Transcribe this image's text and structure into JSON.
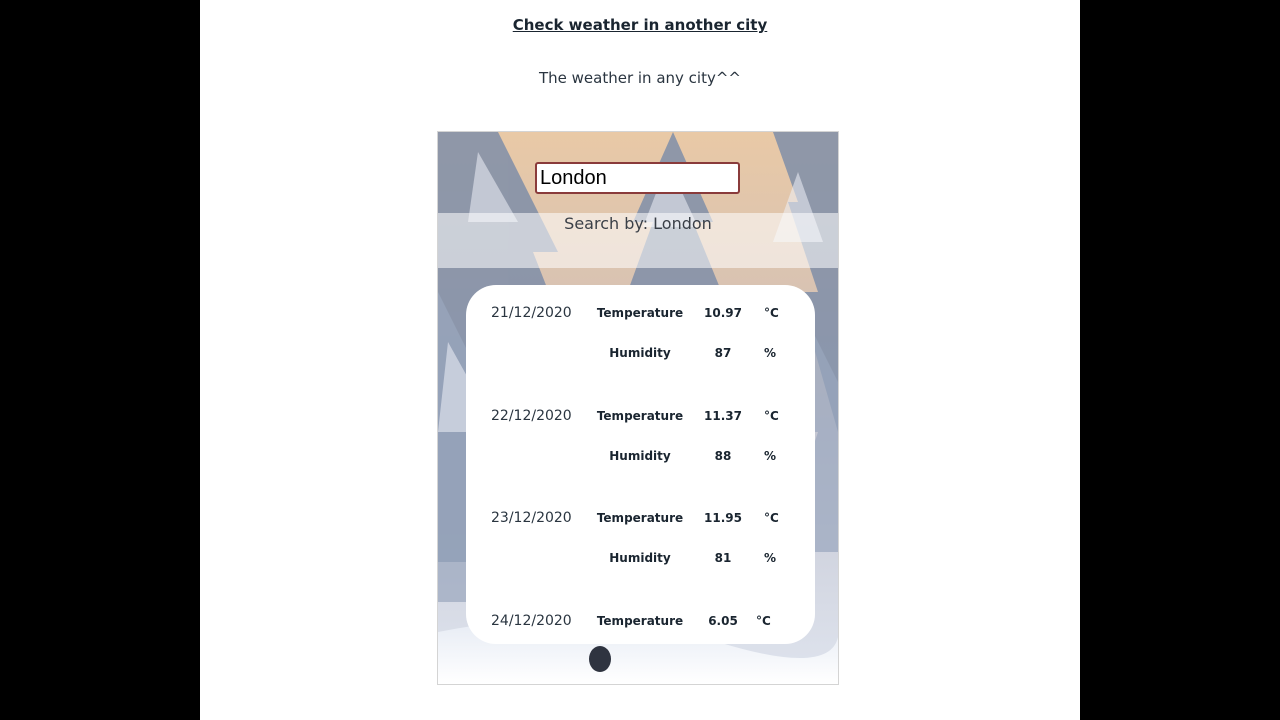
{
  "header": {
    "link_label": "Check weather in another city",
    "subtitle": "The weather in any city^^"
  },
  "search": {
    "input_value": "London",
    "search_by_label": "Search by: London"
  },
  "forecast": [
    {
      "date": "21/12/2020",
      "temperature_label": "Temperature",
      "temperature": "10.97",
      "temperature_unit": "°C",
      "humidity_label": "Humidity",
      "humidity": "87",
      "humidity_unit": "%"
    },
    {
      "date": "22/12/2020",
      "temperature_label": "Temperature",
      "temperature": "11.37",
      "temperature_unit": "°C",
      "humidity_label": "Humidity",
      "humidity": "88",
      "humidity_unit": "%"
    },
    {
      "date": "23/12/2020",
      "temperature_label": "Temperature",
      "temperature": "11.95",
      "temperature_unit": "°C",
      "humidity_label": "Humidity",
      "humidity": "81",
      "humidity_unit": "%"
    },
    {
      "date": "24/12/2020",
      "temperature_label": "Temperature",
      "temperature": "6.05",
      "temperature_unit": "°C"
    }
  ],
  "colors": {
    "outer_background": "#000000",
    "page_background": "#ffffff",
    "text_dark": "#1a2530",
    "input_border": "#8a3b3b"
  }
}
